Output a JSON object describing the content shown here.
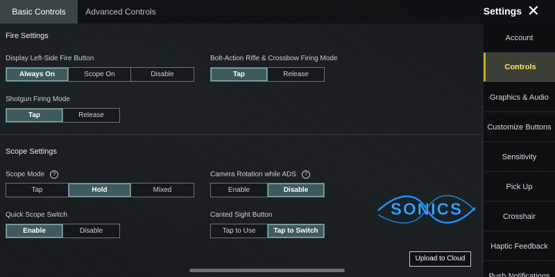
{
  "header": {
    "tabs": [
      {
        "label": "Basic Controls",
        "active": true
      },
      {
        "label": "Advanced Controls",
        "active": false
      }
    ],
    "title": "Settings",
    "close_icon": "close-icon"
  },
  "fire_settings": {
    "title": "Fire Settings",
    "left_fire_button": {
      "label": "Display Left-Side Fire Button",
      "options": [
        "Always On",
        "Scope On",
        "Disable"
      ],
      "selected": "Always On"
    },
    "bolt_action": {
      "label": "Bolt-Action Rifle & Crossbow Firing Mode",
      "options": [
        "Tap",
        "Release"
      ],
      "selected": "Tap"
    },
    "shotgun": {
      "label": "Shotgun Firing Mode",
      "options": [
        "Tap",
        "Release"
      ],
      "selected": "Tap"
    }
  },
  "scope_settings": {
    "title": "Scope Settings",
    "scope_mode": {
      "label": "Scope Mode",
      "options": [
        "Tap",
        "Hold",
        "Mixed"
      ],
      "selected": "Hold",
      "help_icon": "?"
    },
    "camera_rotation": {
      "label": "Camera Rotation while ADS",
      "options": [
        "Enable",
        "Disable"
      ],
      "selected": "Disable",
      "help_icon": "?"
    },
    "quick_scope": {
      "label": "Quick Scope Switch",
      "options": [
        "Enable",
        "Disable"
      ],
      "selected": "Enable"
    },
    "canted_sight": {
      "label": "Canted Sight Button",
      "options": [
        "Tap to Use",
        "Tap to Switch"
      ],
      "selected": "Tap to Switch"
    }
  },
  "sidebar": {
    "items": [
      {
        "label": "Account",
        "active": false
      },
      {
        "label": "Controls",
        "active": true
      },
      {
        "label": "Graphics & Audio",
        "active": false
      },
      {
        "label": "Customize Buttons",
        "active": false
      },
      {
        "label": "Sensitivity",
        "active": false
      },
      {
        "label": "Pick Up",
        "active": false
      },
      {
        "label": "Crosshair",
        "active": false
      },
      {
        "label": "Haptic Feedback",
        "active": false
      },
      {
        "label": "Push Notifications",
        "active": false
      }
    ]
  },
  "footer": {
    "upload_label": "Upload to Cloud"
  },
  "watermark": {
    "text": "SONICS"
  },
  "colors": {
    "active_segment": "#3e5a5d",
    "active_nav_text": "#ffe96a",
    "watermark_blue": "#1e90ff"
  }
}
